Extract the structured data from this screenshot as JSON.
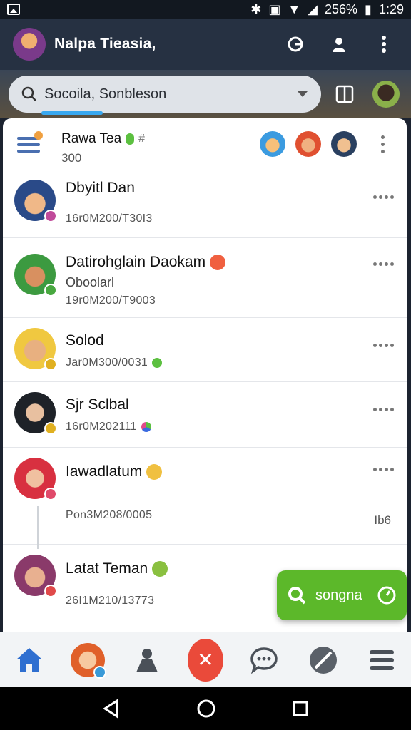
{
  "status_bar": {
    "battery": "256%",
    "time": "1:29"
  },
  "app_bar": {
    "title": "Nalpa Tieasia,"
  },
  "search": {
    "text": "Socoila, Sonbleson"
  },
  "group": {
    "name": "Rawa Tea",
    "count": "300"
  },
  "chats": [
    {
      "name": "Dbyitl Dan",
      "preview": "",
      "time": "16r0M200/T30I3",
      "side": ""
    },
    {
      "name": "Datirohglain Daokam",
      "preview": "Oboolarl",
      "time": "19r0M200/T9003",
      "side": ""
    },
    {
      "name": "Solod",
      "preview": "",
      "time": "Jar0M300/0031",
      "side": ""
    },
    {
      "name": "Sjr Sclbal",
      "preview": "",
      "time": "16r0M202111",
      "side": ""
    },
    {
      "name": "Iawadlatum",
      "preview": "",
      "time": "Pon3M208/0005",
      "side": "Ib6"
    },
    {
      "name": "Latat Teman",
      "preview": "",
      "time": "26I1M210/13773",
      "side": ""
    }
  ],
  "fab": {
    "label": "songna"
  },
  "colors": {
    "accent": "#38a8f0",
    "fab": "#5cb82a",
    "danger": "#ea4a3a",
    "nav_blue": "#2f6fd0"
  }
}
